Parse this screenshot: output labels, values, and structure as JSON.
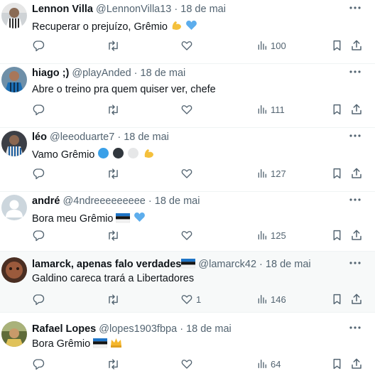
{
  "tweets": [
    {
      "name": "Lennon Villa",
      "handle": "@LennonVilla13",
      "dot": "·",
      "date": "18 de mai",
      "text": "Recuperar o prejuízo, Grêmio",
      "emojis": [
        "flexed-biceps",
        "light-blue-heart"
      ],
      "likes": "",
      "views": "100"
    },
    {
      "name": "hiago ;)",
      "handle": "@playAnded",
      "dot": "·",
      "date": "18 de mai",
      "text": "Abre o treino pra quem quiser ver, chefe",
      "emojis": [],
      "likes": "",
      "views": "111"
    },
    {
      "name": "léo",
      "handle": "@leeoduarte7",
      "dot": "·",
      "date": "18 de mai",
      "text": "Vamo Grêmio",
      "emojis": [
        "blue-circle",
        "black-circle",
        "white-circle",
        "flexed-biceps"
      ],
      "likes": "",
      "views": "127"
    },
    {
      "name": "andré",
      "handle": "@4ndreeeeeeeee",
      "dot": "·",
      "date": "18 de mai",
      "text": "Bora meu Grêmio",
      "emojis": [
        "estonia-flag",
        "light-blue-heart"
      ],
      "likes": "",
      "views": "125"
    },
    {
      "name": "lamarck, apenas falo verdades",
      "handle": "@lamarck42",
      "dot": "·",
      "date": "18 de mai",
      "text": "Galdino careca trará a Libertadores",
      "emojis": [],
      "likes": "1",
      "views": "146"
    },
    {
      "name": "Rafael Lopes",
      "handle": "@lopes1903fbpa",
      "dot": "·",
      "date": "18 de mai",
      "text": "Bora Grêmio",
      "emojis": [
        "estonia-flag",
        "crown"
      ],
      "likes": "",
      "views": "64"
    }
  ],
  "icons": {
    "reply": "reply-icon",
    "retweet": "retweet-icon",
    "like": "like-icon",
    "views": "views-icon",
    "bookmark": "bookmark-icon",
    "share": "share-icon",
    "more": "more-options-icon"
  },
  "colors": {
    "text": "#0f1419",
    "secondary": "#536471",
    "divider": "#eff3f4",
    "highlight": "#f7f9f9"
  }
}
